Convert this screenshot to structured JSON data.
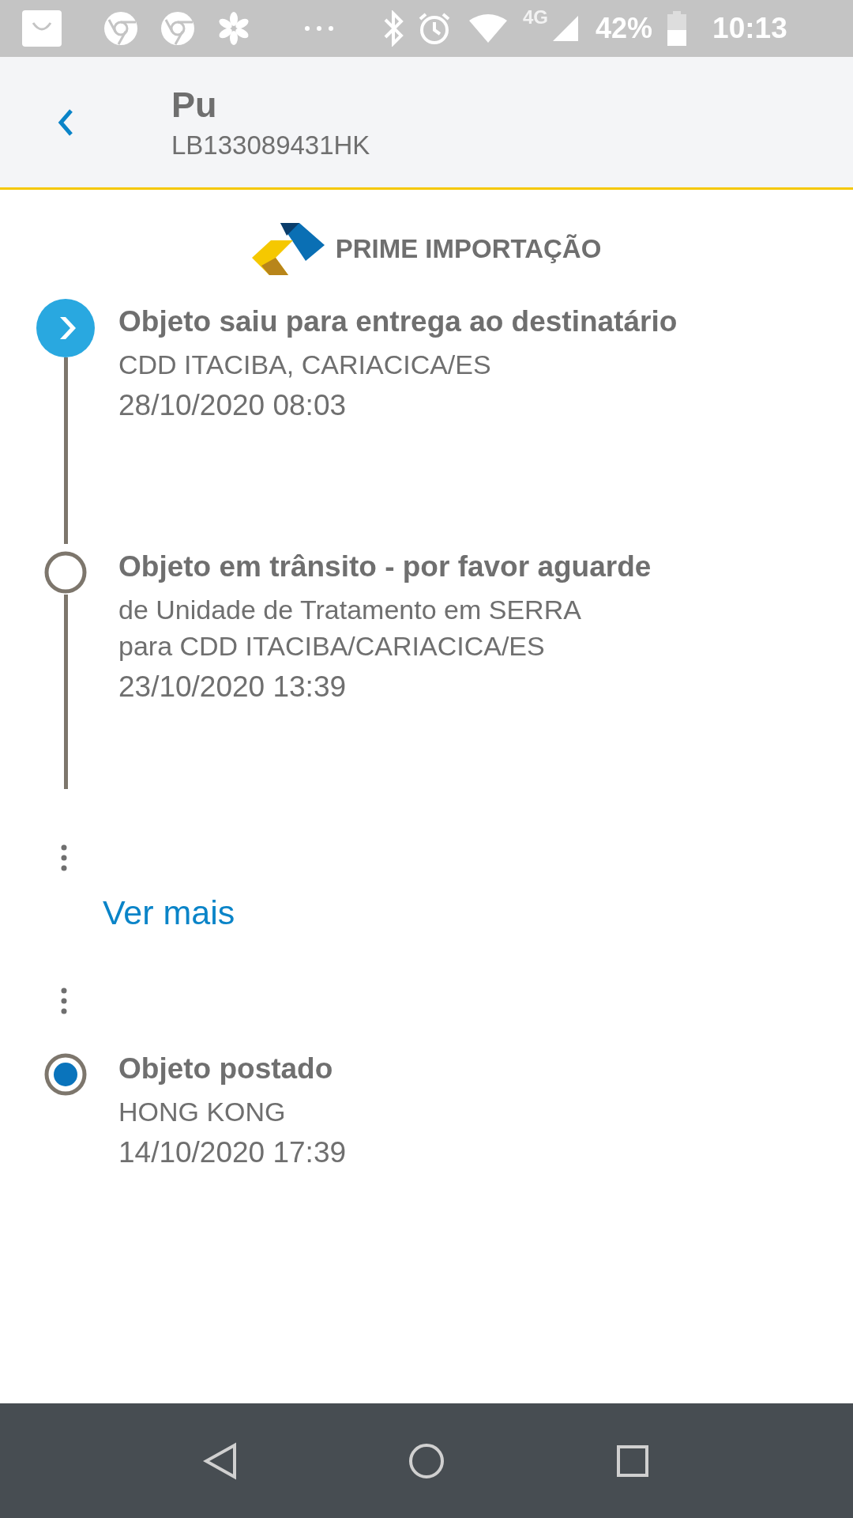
{
  "status_bar": {
    "network": "4G",
    "battery": "42%",
    "time": "10:13"
  },
  "header": {
    "title": "Pu",
    "code": "LB133089431HK"
  },
  "service": {
    "name": "PRIME IMPORTAÇÃO"
  },
  "recent_events": [
    {
      "kind": "current",
      "title": "Objeto saiu para entrega ao destinatário",
      "lines": [
        "CDD ITACIBA, CARIACICA/ES"
      ],
      "date": "28/10/2020 08:03"
    },
    {
      "kind": "past",
      "title": "Objeto em trânsito - por favor aguarde",
      "lines": [
        "de Unidade de Tratamento em SERRA",
        "para CDD ITACIBA/CARIACICA/ES"
      ],
      "date": "23/10/2020 13:39"
    }
  ],
  "more_link": "Ver mais",
  "first_events": [
    {
      "kind": "origin",
      "title": "Objeto postado",
      "lines": [
        "HONG KONG"
      ],
      "date": "14/10/2020 17:39"
    }
  ]
}
